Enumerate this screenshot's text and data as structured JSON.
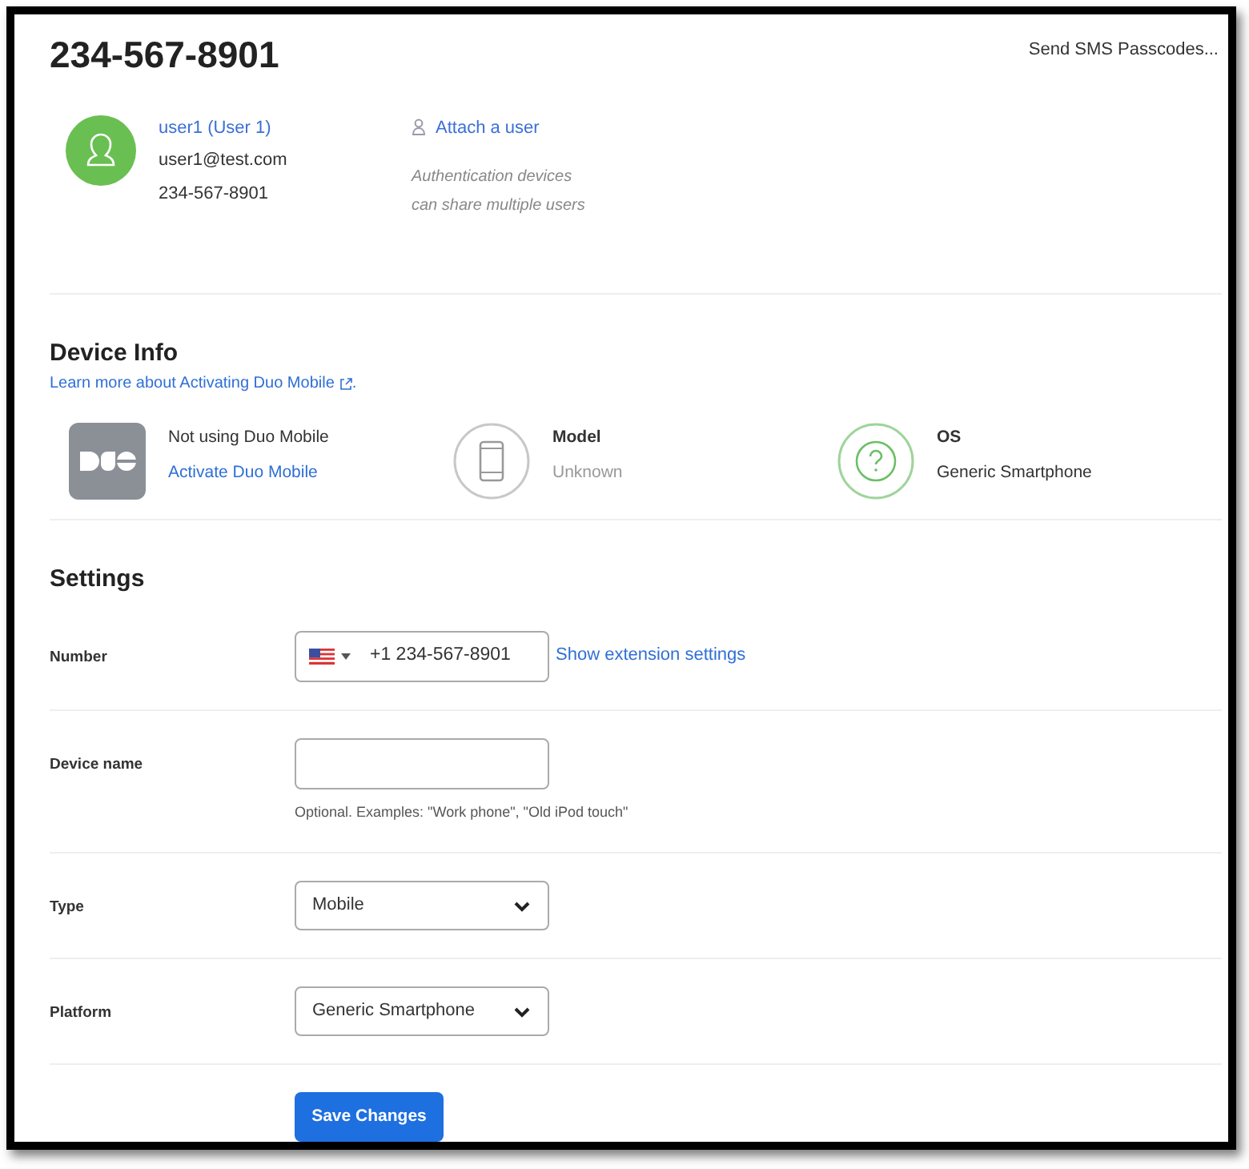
{
  "header": {
    "title": "234-567-8901",
    "action": "Send SMS Passcodes..."
  },
  "user": {
    "name": "user1 (User 1)",
    "email": "user1@test.com",
    "phone": "234-567-8901",
    "attach_link": "Attach a user",
    "note": "Authentication devices can share multiple users"
  },
  "device_info": {
    "heading": "Device Info",
    "learn_link": "Learn more about Activating Duo Mobile",
    "learn_suffix": ".",
    "items": [
      {
        "kind": "duo",
        "title": "Not using Duo Mobile",
        "value": "Activate Duo Mobile"
      },
      {
        "kind": "model",
        "title": "Model",
        "value": "Unknown"
      },
      {
        "kind": "os",
        "title": "OS",
        "value": "Generic Smartphone"
      }
    ]
  },
  "settings": {
    "heading": "Settings",
    "rows": [
      {
        "kind": "phone",
        "label": "Number",
        "value": "+1 234-567-8901",
        "link": "Show extension settings"
      },
      {
        "kind": "text",
        "label": "Device name",
        "hint": "Optional. Examples: \"Work phone\", \"Old iPod touch\""
      },
      {
        "kind": "select",
        "label": "Type",
        "value": "Mobile"
      },
      {
        "kind": "select",
        "label": "Platform",
        "value": "Generic Smartphone"
      }
    ],
    "save_button": "Save Changes"
  }
}
